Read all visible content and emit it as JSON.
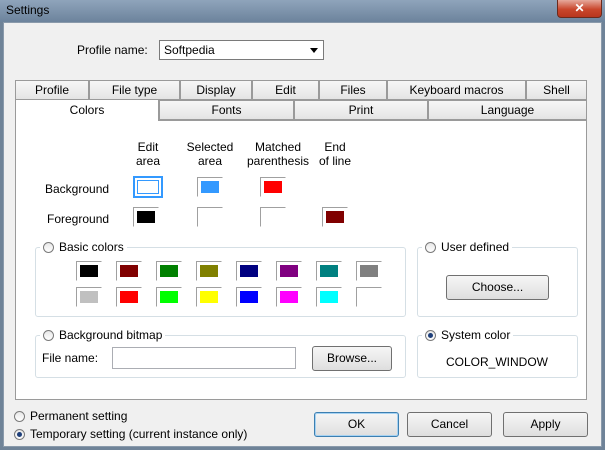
{
  "window": {
    "title": "Settings",
    "close_label": "✕"
  },
  "profile": {
    "label": "Profile name:",
    "value": "Softpedia"
  },
  "tabs_row1": [
    "Profile",
    "File type",
    "Display",
    "Edit",
    "Files",
    "Keyboard macros",
    "Shell"
  ],
  "tabs_row2": [
    "Colors",
    "Fonts",
    "Print",
    "Language"
  ],
  "columns": {
    "edit": [
      "Edit",
      "area"
    ],
    "selected": [
      "Selected",
      "area"
    ],
    "matched": [
      "Matched",
      "parenthesis"
    ],
    "eol": [
      "End",
      "of line"
    ]
  },
  "rows": {
    "background": "Background",
    "foreground": "Foreground"
  },
  "swatch_colors": {
    "bg_edit": "#ffffff",
    "bg_selected": "#3399ff",
    "bg_matched": "#ff0000",
    "fg_edit": "#000000",
    "fg_eol": "#800000"
  },
  "basic_colors": {
    "label": "Basic colors",
    "row1": [
      "#000000",
      "#800000",
      "#008000",
      "#808000",
      "#000080",
      "#800080",
      "#008080",
      "#808080"
    ],
    "row2": [
      "#c0c0c0",
      "#ff0000",
      "#00ff00",
      "#ffff00",
      "#0000ff",
      "#ff00ff",
      "#00ffff",
      "#ffffff"
    ]
  },
  "user_defined": {
    "label": "User defined",
    "choose": "Choose..."
  },
  "bitmap": {
    "label": "Background bitmap",
    "file_label": "File name:",
    "file_value": "",
    "browse": "Browse..."
  },
  "system_color": {
    "label": "System color",
    "value": "COLOR_WINDOW"
  },
  "scope": {
    "permanent": "Permanent setting",
    "temporary": "Temporary setting (current instance only)"
  },
  "buttons": {
    "ok": "OK",
    "cancel": "Cancel",
    "apply": "Apply"
  }
}
